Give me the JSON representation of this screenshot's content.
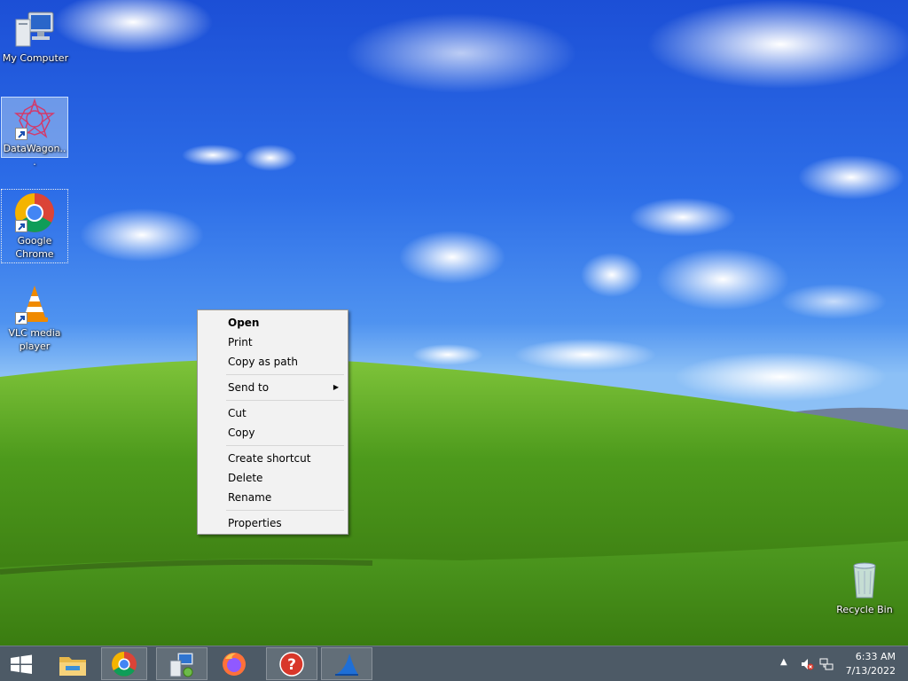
{
  "desktop": {
    "icons": [
      {
        "label": "My Computer"
      },
      {
        "label": "DataWagon..."
      },
      {
        "label": "Google Chrome"
      },
      {
        "label": "VLC media player"
      },
      {
        "label": "Recycle Bin"
      }
    ]
  },
  "context_menu": {
    "groups": [
      [
        "Open",
        "Print",
        "Copy as path"
      ],
      [
        "Send to"
      ],
      [
        "Cut",
        "Copy"
      ],
      [
        "Create shortcut",
        "Delete",
        "Rename"
      ],
      [
        "Properties"
      ]
    ],
    "items": {
      "open": "Open",
      "print": "Print",
      "copy_as_path": "Copy as path",
      "send_to": "Send to",
      "cut": "Cut",
      "copy": "Copy",
      "create_shortcut": "Create shortcut",
      "delete": "Delete",
      "rename": "Rename",
      "properties": "Properties"
    }
  },
  "taskbar": {
    "pinned": [
      "file-explorer-icon",
      "chrome-icon",
      "network-computer-icon",
      "firefox-icon",
      "help-icon",
      "wireshark-icon"
    ],
    "clock": {
      "time": "6:33 AM",
      "date": "7/13/2022"
    }
  },
  "colors": {
    "taskbar": "#4d5a66",
    "menu_bg": "#f2f2f2",
    "selection": "#aac8f0"
  }
}
